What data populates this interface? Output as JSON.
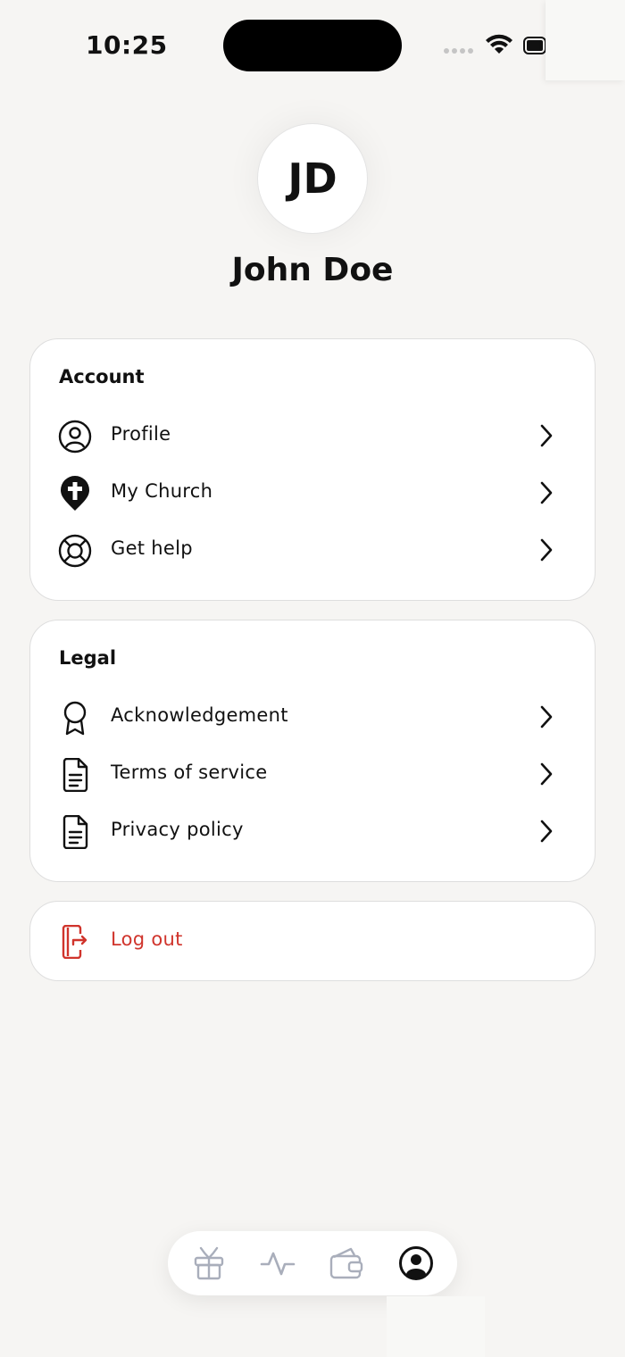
{
  "status_bar": {
    "time": "10:25"
  },
  "profile": {
    "initials": "JD",
    "name": "John Doe"
  },
  "account_section": {
    "title": "Account",
    "items": [
      {
        "label": "Profile",
        "icon": "user-circle-icon"
      },
      {
        "label": "My Church",
        "icon": "church-pin-icon"
      },
      {
        "label": "Get help",
        "icon": "lifebuoy-icon"
      }
    ]
  },
  "legal_section": {
    "title": "Legal",
    "items": [
      {
        "label": "Acknowledgement",
        "icon": "award-ribbon-icon"
      },
      {
        "label": "Terms of service",
        "icon": "document-icon"
      },
      {
        "label": "Privacy policy",
        "icon": "document-icon"
      }
    ]
  },
  "logout": {
    "label": "Log out",
    "icon": "logout-icon"
  },
  "tab_bar": {
    "tabs": [
      {
        "icon": "gift-icon",
        "active": false
      },
      {
        "icon": "activity-icon",
        "active": false
      },
      {
        "icon": "wallet-icon",
        "active": false
      },
      {
        "icon": "profile-icon",
        "active": true
      }
    ]
  },
  "colors": {
    "background": "#f6f5f3",
    "card": "#ffffff",
    "text": "#111111",
    "danger": "#d0342c",
    "inactive_tab": "#a9aebb"
  }
}
